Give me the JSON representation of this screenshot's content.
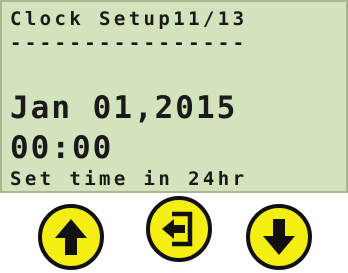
{
  "display": {
    "title_line": "Clock Setup11/13",
    "separator_line": "----------------",
    "date_line": "Jan 01,2015",
    "time_line": "00:00",
    "hint_line": "Set time in 24hr"
  },
  "buttons": [
    {
      "name": "up-button",
      "icon": "arrow-up-icon"
    },
    {
      "name": "enter-button",
      "icon": "enter-icon"
    },
    {
      "name": "down-button",
      "icon": "arrow-down-icon"
    }
  ],
  "colors": {
    "lcd_background": "#d3e3bd",
    "lcd_text": "#1a1a1a",
    "button_fill": "#f5ee12",
    "button_outline": "#111111"
  }
}
